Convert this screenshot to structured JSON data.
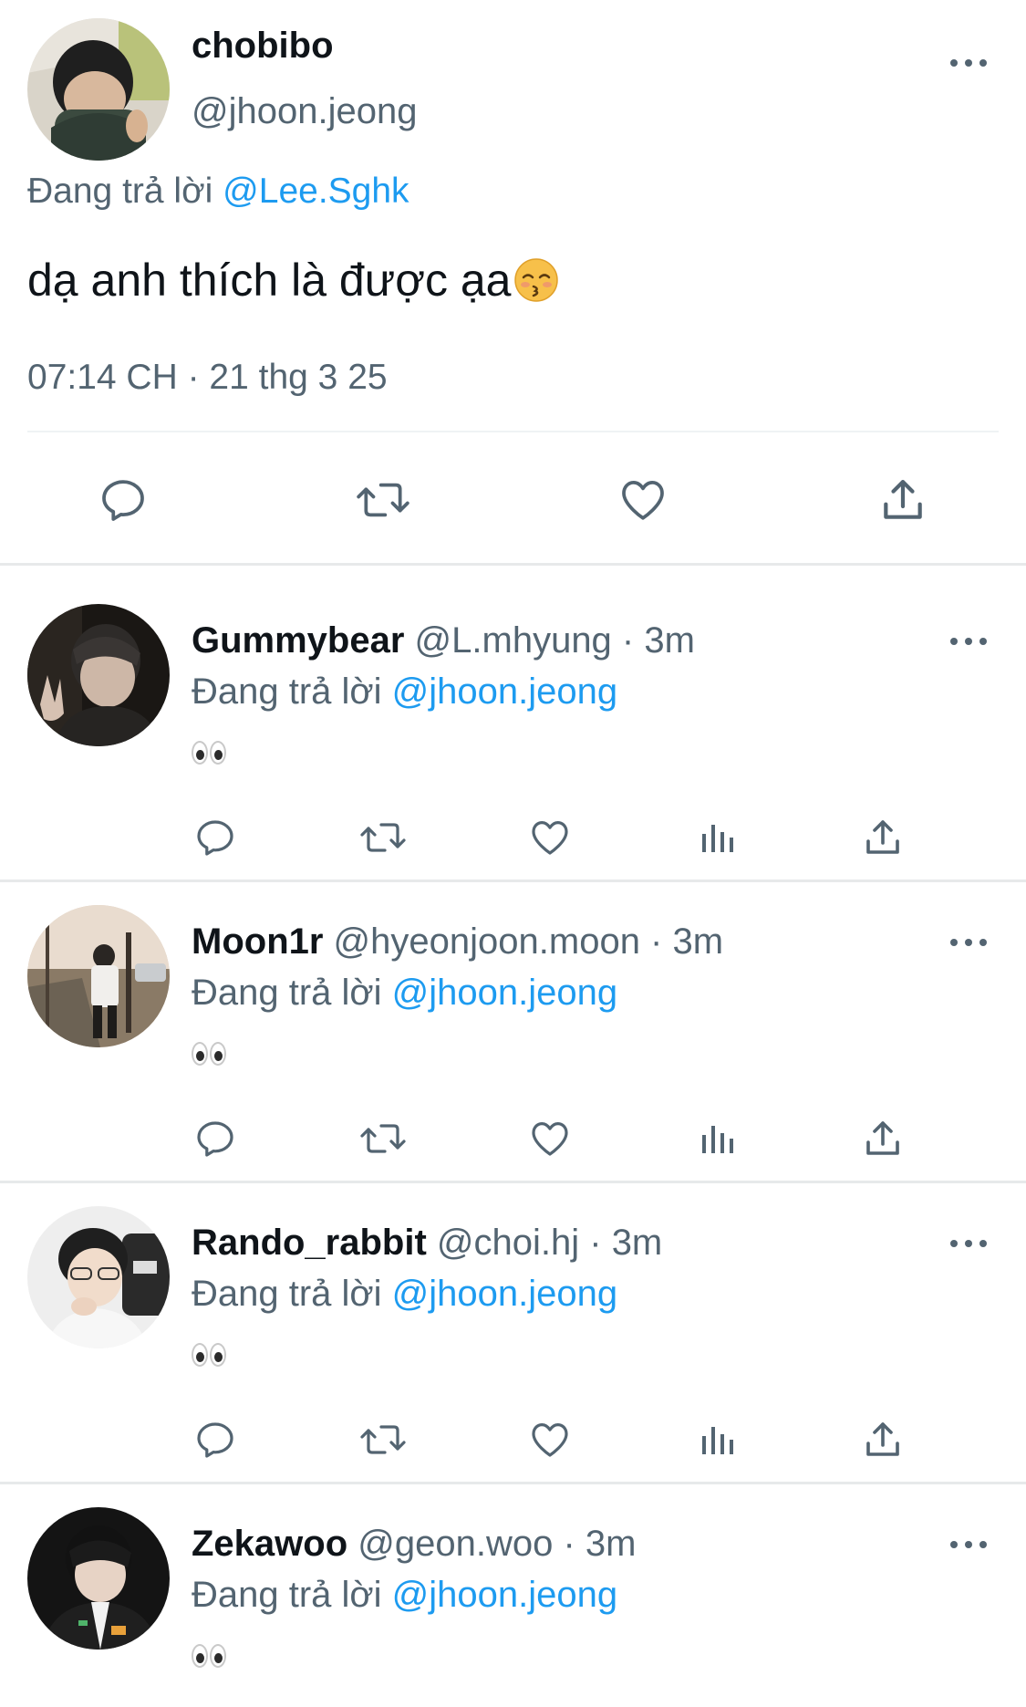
{
  "main_tweet": {
    "display_name": "chobibo",
    "handle": "@jhoon.jeong",
    "replying_prefix": "Đang trả lời ",
    "replying_to": "@Lee.Sghk",
    "text": "dạ anh thích là được ạa",
    "emoji": "kissing-face-emoji",
    "timestamp": "07:14 CH · 21 thg 3 25",
    "actions": [
      "reply-icon",
      "retweet-icon",
      "like-icon",
      "share-icon"
    ]
  },
  "replies": [
    {
      "display_name": "Gummybear",
      "handle_time": " @L.mhyung · 3m",
      "replying_prefix": "Đang trả lời ",
      "replying_to": "@jhoon.jeong",
      "content_emoji": "eyes-emoji"
    },
    {
      "display_name": "Moon1r",
      "handle_time": " @hyeonjoon.moon · 3m",
      "replying_prefix": "Đang trả lời ",
      "replying_to": "@jhoon.jeong",
      "content_emoji": "eyes-emoji"
    },
    {
      "display_name": "Rando_rabbit",
      "handle_time": " @choi.hj · 3m",
      "replying_prefix": "Đang trả lời ",
      "replying_to": "@jhoon.jeong",
      "content_emoji": "eyes-emoji"
    },
    {
      "display_name": "Zekawoo",
      "handle_time": " @geon.woo · 3m",
      "replying_prefix": "Đang trả lời ",
      "replying_to": "@jhoon.jeong",
      "content_emoji": "eyes-emoji"
    }
  ],
  "colors": {
    "text": "#0f1419",
    "secondary": "#536471",
    "link": "#1d9bf0",
    "divider": "#e7e9ea"
  }
}
